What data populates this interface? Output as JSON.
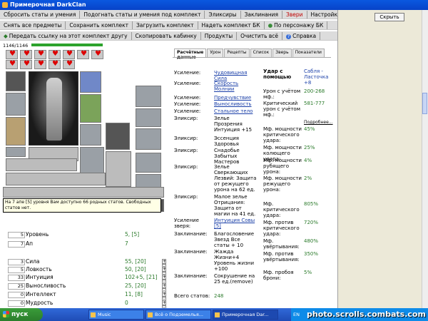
{
  "window": {
    "title": "Примерочная DarkClan"
  },
  "side": {
    "hide_label": "Скрыть"
  },
  "menu": {
    "row1": [
      "Сбросить статы и умения",
      "Подогнать статы и умения под комплект",
      "Эликсиры",
      "Заклинания",
      "Звери",
      "Настройки"
    ],
    "row2": [
      "Снять все предметы",
      "Сохранить комплект",
      "Загрузить комплект",
      "Надеть комплект БК",
      "По персонажу БК"
    ],
    "row3": [
      "Передать ссылку на этот комплект другу",
      "Скопировать кабинку",
      "Продукты",
      "Очистить всё",
      "Справка"
    ]
  },
  "char": {
    "hp": "1146/1146",
    "hp_fraction": 1.0
  },
  "tooltip": {
    "text": "На 7 апе [5] уровня Вам доступно 66 родных статов. Свободных статов нет."
  },
  "stats": [
    {
      "box": "5",
      "label": "Уровень",
      "val": "5, [5]"
    },
    {
      "box": "7",
      "label": "Ап",
      "val": "7"
    },
    {
      "box": "3",
      "label": "Сила",
      "val": "55, [20]"
    },
    {
      "box": "5",
      "label": "Ловкость",
      "val": "50, [20]"
    },
    {
      "box": "33",
      "label": "Интуиция",
      "val": "102+5, [21]"
    },
    {
      "box": "25",
      "label": "Выносливость",
      "val": "25, [20]"
    },
    {
      "box": "0",
      "label": "Интеллект",
      "val": "11, [8]"
    },
    {
      "box": "0",
      "label": "Мудрость",
      "val": "0"
    }
  ],
  "tabs": [
    "Расчётные данные",
    "Урон",
    "Рецепты",
    "Список",
    "Зверь",
    "Показатели"
  ],
  "effects": [
    {
      "k": "Усиление:",
      "v": "Чудовищная Сила",
      "cls": "link"
    },
    {
      "k": "Усиление:",
      "v": "Скорость Молнии",
      "cls": "link"
    },
    {
      "k": "Усиление:",
      "v": "Предчувствие",
      "cls": "link"
    },
    {
      "k": "Усиление:",
      "v": "Выносливость",
      "cls": "link"
    },
    {
      "k": "Усиление:",
      "v": "Стальное тело",
      "cls": "link"
    },
    {
      "k": "Эликсир:",
      "v": "Зелье Прозрения Интуиция +15",
      "cls": ""
    },
    {
      "k": "Эликсир:",
      "v": "Эссенция Здоровья",
      "cls": ""
    },
    {
      "k": "Эликсир:",
      "v": "Снадобье Забытых Мастеров",
      "cls": ""
    },
    {
      "k": "Эликсир:",
      "v": "Зелье Сверкающих Лезвий: Защита от режущего урона на 62 ед.",
      "cls": ""
    },
    {
      "k": "Эликсир:",
      "v": "Малое зелье Отрицания: Защита от магии на 41 ед.",
      "cls": ""
    },
    {
      "k": "Усиление зверя:",
      "v": "Интуиция Совы [5]",
      "cls": "link"
    },
    {
      "k": "Заклинание:",
      "v": "Благословение Звезд Все статы + 10",
      "cls": ""
    },
    {
      "k": "Заклинание:",
      "v": "Жажда Жизни+4 Уровень жизни +100",
      "cls": ""
    },
    {
      "k": "Заклинание:",
      "v": "Сокрушение на 25 ед.(remove)",
      "cls": ""
    },
    {
      "k": "Всего статов:",
      "v": "248",
      "cls": "num"
    }
  ],
  "calc": {
    "header_left": "Удар с помощью",
    "header_right": "Сабля - Ласточка +8",
    "rows": [
      {
        "l": "Урон с учётом мф.:",
        "v": "200-268"
      },
      {
        "l": "Критический урон с учётом мф.:",
        "v": "581-777"
      },
      {
        "l": "Подробнее...",
        "v": ""
      },
      {
        "l": "Мф. мощности критического удара:",
        "v": "45%"
      },
      {
        "l": "Мф. мощности колющего удара:",
        "v": "25%"
      },
      {
        "l": "Мф. мощности рубящего урона:",
        "v": "4%"
      },
      {
        "l": "Мф. мощности режущего урона:",
        "v": "2%"
      },
      {
        "l": "Мф. критического удара:",
        "v": "805%"
      },
      {
        "l": "Мф. против критического удара:",
        "v": "720%"
      },
      {
        "l": "Мф. увёртывания:",
        "v": "480%"
      },
      {
        "l": "Мф. против увёртывания:",
        "v": "350%"
      },
      {
        "l": "Мф. пробоя брони:",
        "v": "5%"
      }
    ]
  },
  "taskbar": {
    "start": "пуск",
    "tasks": [
      "Music",
      "Всё о Подземелья...",
      "Примерочная Dar...",
      ""
    ],
    "lang": "EN",
    "watermark": "photo.scrolls.combats.com"
  }
}
